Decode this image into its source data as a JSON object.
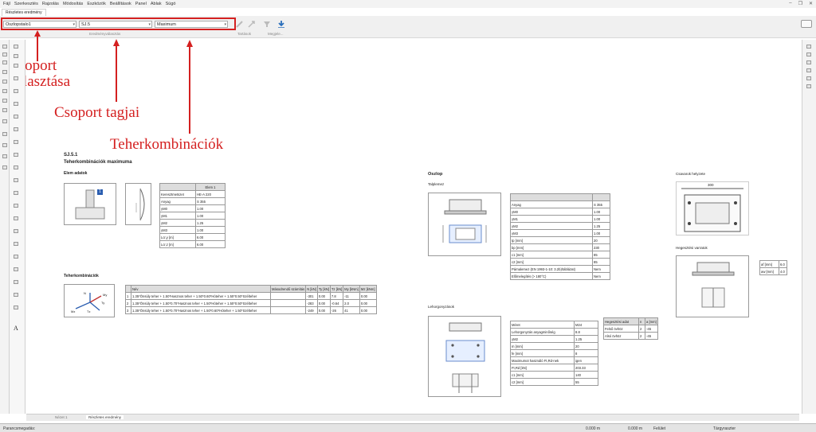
{
  "menu": [
    "Fájl",
    "Szerkesztés",
    "Rajzolás",
    "Módosítás",
    "Eszközök",
    "Beállítások",
    "Panel",
    "Ablak",
    "Súgó"
  ],
  "doc_tab": "Részletes eredmény",
  "toolbar": {
    "group_select": "Oszlopstalo1",
    "member_select": "SJ.5",
    "combination_select": "Maximum",
    "group_label_results": "Eredményválasztás",
    "group_label_tartasok": "Tartások",
    "group_label_megjel": "Megjele..."
  },
  "annotations": {
    "a1_line1": "Csoport",
    "a1_line2": "választása",
    "a2": "Csoport tagjai",
    "a3": "Teherkombinációk"
  },
  "report": {
    "id": "SJ.5.1",
    "subtitle": "Teherkombinációk maximuma",
    "elem_heading": "Elem adatok",
    "elem_table": {
      "header": "Elem 1",
      "rows": [
        [
          "Keresztmetszet",
          "HE-A 220"
        ],
        [
          "Anyag",
          "S 355"
        ],
        [
          "γM0",
          "1.00"
        ],
        [
          "γM1",
          "1.00"
        ],
        [
          "γM2",
          "1.25"
        ],
        [
          "γM3",
          "1.00"
        ],
        [
          "Lcr,y [m]",
          "6.00"
        ],
        [
          "Lcr,z [m]",
          "6.00"
        ]
      ]
    },
    "comb_heading": "Teherkombinációk",
    "comb_table": {
      "headers": [
        "Név",
        "Másodrendű számítás",
        "N [kN]",
        "Ty [kN]",
        "Tz [kN]",
        "My [kNm]",
        "Mz [kNm]"
      ],
      "rows": [
        [
          "1",
          "1.35*Önsúly teher + 1.50*Hasznos teher + 1.50*0.60*Hóteher + 1.50*0.50*Szélteher",
          "",
          "-301",
          "0.00",
          "7.8",
          "-11",
          "0.00"
        ],
        [
          "2",
          "1.35*Önsúly teher + 1.50*0.70*Hasznos teher + 1.50*Hóteher + 1.50*0.50*Szélteher",
          "",
          "-283",
          "0.00",
          "-0.64",
          "2.0",
          "0.00"
        ],
        [
          "3",
          "1.35*Önsúly teher + 1.50*0.70*Hasznos teher + 1.50*0.60*Hóteher + 1.50*Szélteher",
          "",
          "-249",
          "0.00",
          "-26",
          "41",
          "0.00"
        ]
      ]
    },
    "oszlop_heading": "Oszlop",
    "talplemez_label": "Talplemez",
    "talplemez_table": [
      [
        "Anyag",
        "S 355"
      ],
      [
        "γM0",
        "1.00"
      ],
      [
        "γM1",
        "1.00"
      ],
      [
        "γM2",
        "1.25"
      ],
      [
        "γM3",
        "1.00"
      ],
      [
        "tp [mm]",
        "20"
      ],
      [
        "bp [mm]",
        "230"
      ],
      [
        "c1 [mm]",
        "85"
      ],
      [
        "c2 [mm]",
        "85"
      ],
      [
        "Párnalemez (EN 1993-1-10: 3.2b)/táblázat)",
        "Nem"
      ],
      [
        "Előmelegítés (> 180°C)",
        "Nem"
      ]
    ],
    "lehorgonyzas_label": "Lehorgonyzások",
    "lehorgonyzas_table": [
      [
        "Méret",
        "M24"
      ],
      [
        "Lehorgonyzás anyagminőség",
        "8.8"
      ],
      [
        "γM2",
        "1.25"
      ],
      [
        "m [mm]",
        "20"
      ],
      [
        "fe [mm]",
        "8"
      ],
      [
        "Maximumot használó Ft,Rd-nek",
        "igen"
      ],
      [
        "Ft,Rd [kN]",
        "203.33"
      ],
      [
        "c1 [mm]",
        "140"
      ],
      [
        "c2 [mm]",
        "55"
      ]
    ],
    "hegesztes_table": {
      "headers": [
        "Hegesztési adat",
        "n",
        "a [mm]"
      ],
      "rows": [
        [
          "Felső övhöz",
          "2",
          "-45"
        ],
        [
          "Alsó övhöz",
          "2",
          "-45"
        ]
      ]
    },
    "csavarok_label": "Csavarok helyzete",
    "csavar_dim": "300",
    "hegesztesi_varratok_label": "Hegesztési varratok",
    "hv_table": [
      [
        "af [mm]",
        "6.0"
      ],
      [
        "aw [mm]",
        "4.0"
      ]
    ],
    "load_arrows": {
      "n": "N",
      "my": "My",
      "mz": "Mz",
      "tz": "Tz",
      "ty": "Ty"
    },
    "elem_badge": "1"
  },
  "bottom": {
    "tab1": "Nézet 1",
    "tab2": "Részletes eredmény"
  },
  "status": {
    "left": "Parancsmegadás:",
    "x": "0.000 m",
    "y": "0.000 m",
    "felulet": "Felület",
    "mode": "Tárgyraszter"
  },
  "colors": {
    "annotation": "#d42020"
  }
}
